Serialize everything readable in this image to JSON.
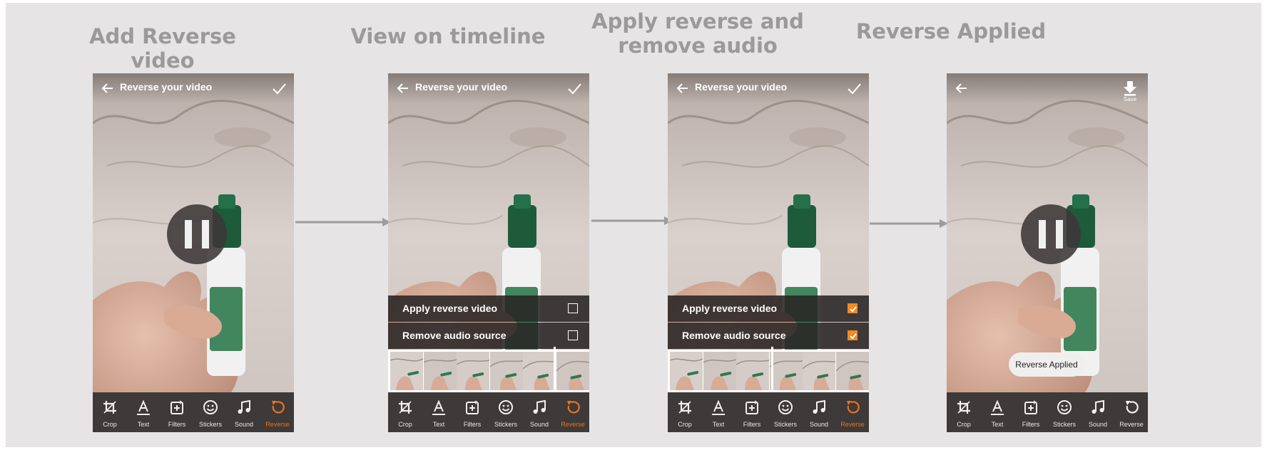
{
  "colors": {
    "canvas_bg": "#e6e4e5",
    "title_gray": "#9a9a9a",
    "toolbar_bg": "#3d3a39",
    "accent_orange": "#e8731e",
    "checkbox_orange": "#f08a24"
  },
  "steps": [
    {
      "title": "Add Reverse video",
      "topbar_title": "Reverse your video",
      "topbar_right_icon": "check-icon",
      "show_pause": true,
      "active_tool": "Reverse",
      "options": []
    },
    {
      "title": "View on timeline",
      "topbar_title": "Reverse your video",
      "topbar_right_icon": "check-icon",
      "show_pause": false,
      "active_tool": "Reverse",
      "options": [
        {
          "label": "Apply reverse video",
          "checked": false
        },
        {
          "label": "Remove audio source",
          "checked": false
        }
      ]
    },
    {
      "title": "Apply reverse and\nremove audio",
      "topbar_title": "Reverse your video",
      "topbar_right_icon": "check-icon",
      "show_pause": false,
      "active_tool": "Reverse",
      "options": [
        {
          "label": "Apply reverse video",
          "checked": true
        },
        {
          "label": "Remove audio source",
          "checked": true
        }
      ]
    },
    {
      "title": "Reverse Applied",
      "topbar_title": "",
      "topbar_right_icon": "download-icon",
      "save_label": "Save",
      "show_pause": true,
      "active_tool": "",
      "toast": "Reverse Applied",
      "options": []
    }
  ],
  "toolbar": {
    "tools": [
      {
        "label": "Crop",
        "icon": "crop-icon"
      },
      {
        "label": "Text",
        "icon": "text-icon"
      },
      {
        "label": "Filters",
        "icon": "filters-icon"
      },
      {
        "label": "Stickers",
        "icon": "stickers-icon"
      },
      {
        "label": "Sound",
        "icon": "sound-icon"
      },
      {
        "label": "Reverse",
        "icon": "reverse-icon"
      }
    ]
  }
}
